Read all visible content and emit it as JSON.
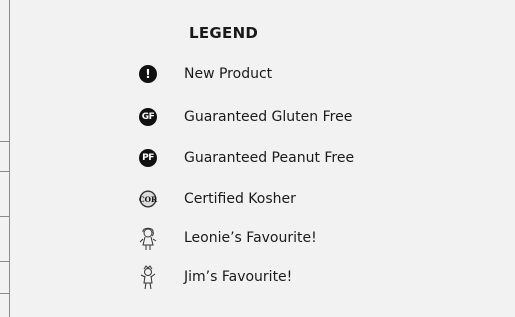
{
  "legend": {
    "title": "LEGEND",
    "items": [
      {
        "icon": "new-product-icon",
        "label": "New Product"
      },
      {
        "icon": "gluten-free-icon",
        "label": "Guaranteed Gluten Free",
        "badge": "GF"
      },
      {
        "icon": "peanut-free-icon",
        "label": "Guaranteed Peanut Free",
        "badge": "PF"
      },
      {
        "icon": "kosher-cor-icon",
        "label": "Certified Kosher",
        "badge": "COR"
      },
      {
        "icon": "leonie-figure-icon",
        "label": "Leonie’s Favourite!"
      },
      {
        "icon": "jim-figure-icon",
        "label": "Jim’s Favourite!"
      }
    ]
  }
}
